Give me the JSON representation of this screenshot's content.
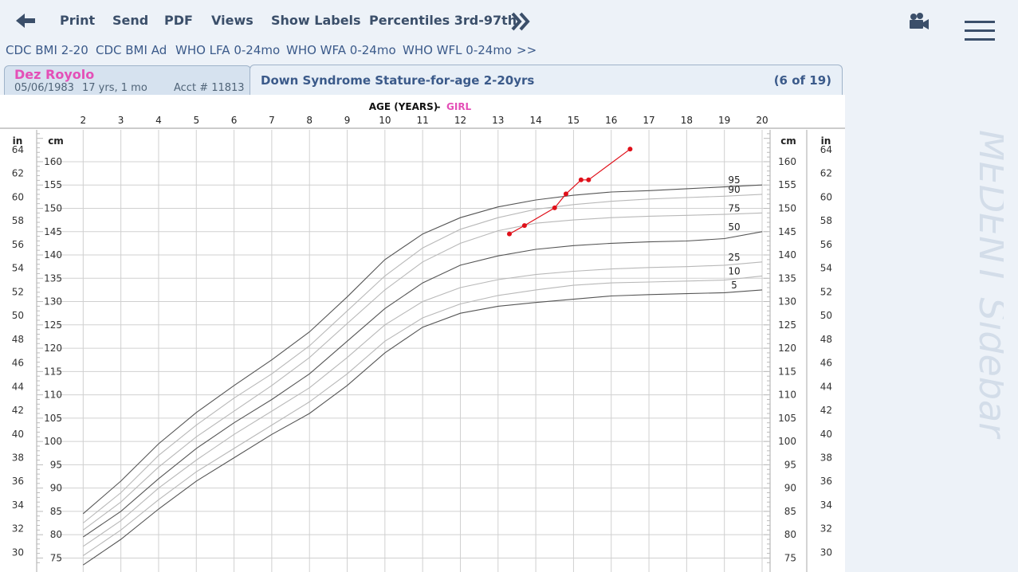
{
  "toolbar": {
    "back_icon": "arrow-left-icon",
    "print": "Print",
    "send": "Send",
    "pdf": "PDF",
    "views": "Views",
    "show_labels": "Show Labels",
    "percentiles": "Percentiles 3rd-97th",
    "more_icon": "double-chevron-right-icon"
  },
  "chart_tabs": [
    "CDC BMI 2-20",
    "CDC BMI Ad",
    "WHO LFA 0-24mo",
    "WHO WFA 0-24mo",
    "WHO WFL 0-24mo",
    ">>"
  ],
  "patient": {
    "name": "Dez Royolo",
    "dob": "05/06/1983",
    "age": "17 yrs, 1 mo",
    "acct": "Acct # 11813"
  },
  "chart_header": {
    "title": "Down Syndrome Stature-for-age 2-20yrs",
    "count": "(6 of 19)"
  },
  "sidebar": {
    "video_icon": "video-camera-icon",
    "menu_icon": "hamburger-menu-icon",
    "watermark": "MEDENT Sidebar"
  },
  "colors": {
    "accent": "#3b5a8a",
    "patient_name": "#e44fb7",
    "girl": "#e44fb7",
    "patient_line": "#e0101a",
    "percentile_major": "#555555",
    "percentile_minor": "#b8b8b8"
  },
  "chart_data": {
    "type": "line",
    "axis_title": "AGE (YEARS)",
    "axis_title_sep": "-",
    "sex_label": "GIRL",
    "xlim": [
      1,
      20
    ],
    "x_ticks": [
      2,
      3,
      4,
      5,
      6,
      7,
      8,
      9,
      10,
      11,
      12,
      13,
      14,
      15,
      16,
      17,
      18,
      19,
      20
    ],
    "ylim_cm": [
      72,
      167
    ],
    "y_ticks_cm": [
      75,
      80,
      85,
      90,
      95,
      100,
      105,
      110,
      115,
      120,
      125,
      130,
      135,
      140,
      145,
      150,
      155,
      160
    ],
    "y_ticks_in": [
      30,
      32,
      34,
      36,
      38,
      40,
      42,
      44,
      46,
      48,
      50,
      52,
      54,
      56,
      58,
      60,
      62,
      64
    ],
    "y_unit_cm": "cm",
    "y_unit_in": "in",
    "x": [
      2,
      3,
      4,
      5,
      6,
      7,
      8,
      9,
      10,
      11,
      12,
      13,
      14,
      15,
      16,
      17,
      18,
      19,
      20
    ],
    "series": [
      {
        "name": "95",
        "major": true,
        "values": [
          84.5,
          91.5,
          99.5,
          106.2,
          112,
          117.5,
          123.5,
          131,
          139,
          144.5,
          148,
          150.3,
          151.8,
          152.8,
          153.5,
          153.8,
          154.2,
          154.6,
          155
        ]
      },
      {
        "name": "90",
        "major": false,
        "values": [
          82.5,
          89,
          97,
          103.5,
          109.3,
          114.5,
          120.5,
          128,
          135.5,
          141.5,
          145.5,
          148,
          149.8,
          150.8,
          151.5,
          152,
          152.3,
          152.6,
          153
        ]
      },
      {
        "name": "75",
        "major": false,
        "values": [
          81,
          87,
          94.5,
          101,
          106.5,
          112,
          118,
          125.3,
          132.5,
          138.5,
          142.5,
          145.2,
          146.8,
          147.5,
          148,
          148.3,
          148.5,
          148.7,
          149
        ]
      },
      {
        "name": "50",
        "major": true,
        "values": [
          79.5,
          85,
          92,
          98.5,
          104,
          109,
          114.5,
          121.5,
          128.5,
          134,
          137.8,
          139.8,
          141.2,
          142,
          142.5,
          142.8,
          143,
          143.5,
          145
        ]
      },
      {
        "name": "25",
        "major": false,
        "values": [
          77.5,
          83,
          90,
          96,
          101.5,
          106.5,
          111.5,
          118,
          125,
          130,
          133,
          134.7,
          135.8,
          136.5,
          137,
          137.3,
          137.5,
          137.8,
          138.5
        ]
      },
      {
        "name": "10",
        "major": false,
        "values": [
          75.5,
          81,
          87.5,
          93.5,
          98.5,
          103.5,
          108.5,
          114.5,
          121.5,
          126.5,
          129.5,
          131.3,
          132.5,
          133.5,
          134,
          134.2,
          134.4,
          134.6,
          135.5
        ]
      },
      {
        "name": "5",
        "major": true,
        "values": [
          73.5,
          79,
          85.5,
          91.5,
          96.5,
          101.5,
          106,
          112,
          119,
          124.5,
          127.5,
          129,
          129.8,
          130.5,
          131.2,
          131.5,
          131.7,
          131.9,
          132.5
        ]
      }
    ],
    "patient": {
      "x": [
        13.3,
        13.7,
        14.5,
        14.8,
        15.2,
        15.4,
        16.5
      ],
      "y": [
        144.5,
        146.3,
        150.1,
        153.1,
        156.1,
        156.1,
        162.7
      ]
    }
  }
}
